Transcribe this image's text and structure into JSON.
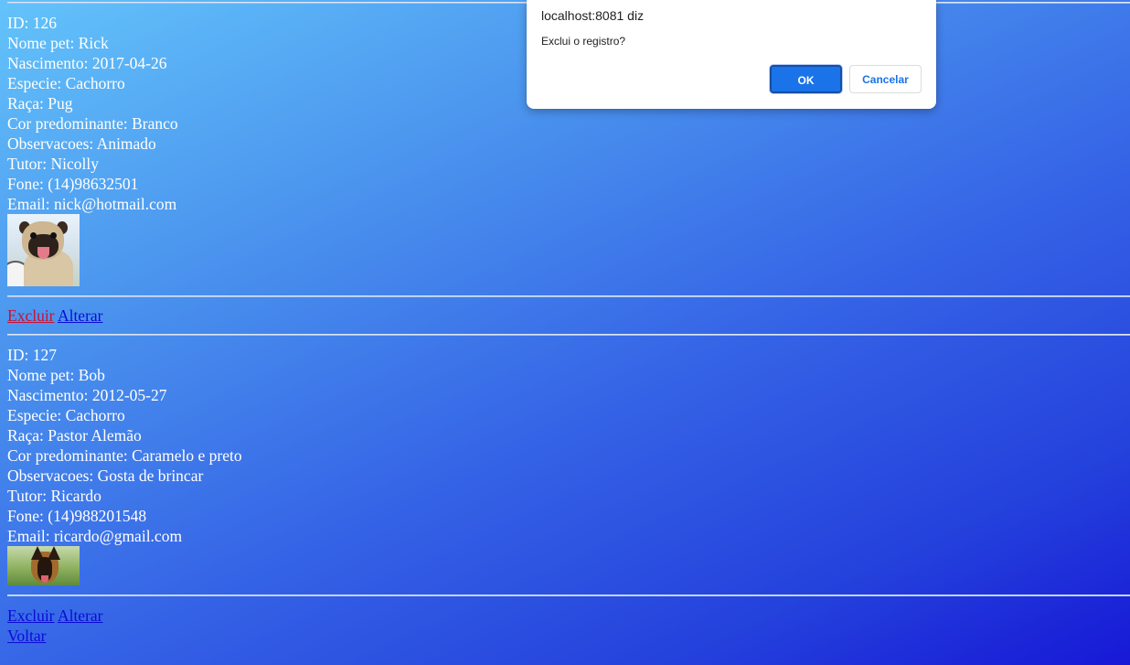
{
  "records": [
    {
      "id": "ID: 126",
      "nome": "Nome pet: Rick",
      "nascimento": "Nascimento: 2017-04-26",
      "especie": "Especie: Cachorro",
      "raca": "Raça: Pug",
      "cor": "Cor predominante: Branco",
      "observacoes": "Observacoes: Animado",
      "tutor": "Tutor: Nicolly",
      "fone": "Fone: (14)98632501",
      "email": "Email: nick@hotmail.com",
      "excluir_label": "Excluir",
      "alterar_label": "Alterar"
    },
    {
      "id": "ID: 127",
      "nome": "Nome pet: Bob",
      "nascimento": "Nascimento: 2012-05-27",
      "especie": "Especie: Cachorro",
      "raca": "Raça: Pastor Alemão",
      "cor": "Cor predominante: Caramelo e preto",
      "observacoes": "Observacoes: Gosta de brincar",
      "tutor": "Tutor: Ricardo",
      "fone": "Fone: (14)988201548",
      "email": "Email: ricardo@gmail.com",
      "excluir_label": "Excluir",
      "alterar_label": "Alterar"
    }
  ],
  "voltar_label": "Voltar",
  "dialog": {
    "title": "localhost:8081 diz",
    "message": "Exclui o registro?",
    "ok_label": "OK",
    "cancel_label": "Cancelar"
  },
  "colors": {
    "link": "#0b0bd6",
    "visited_link": "#c81036",
    "dialog_primary": "#1a73e8"
  }
}
